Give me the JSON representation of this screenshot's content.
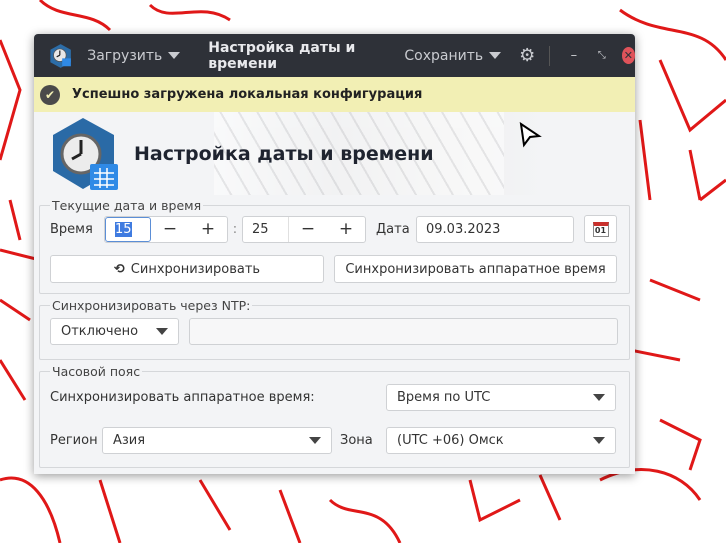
{
  "titlebar": {
    "load_label": "Загрузить",
    "title": "Настройка даты и времени",
    "save_label": "Сохранить",
    "minimize": "–",
    "restore": "⤡",
    "close": "✕"
  },
  "banner": {
    "message": "Успешно загружена локальная конфигурация"
  },
  "header": {
    "title": "Настройка даты и времени"
  },
  "current": {
    "legend": "Текущие дата и время",
    "time_label": "Время",
    "hours": "15",
    "minutes": "25",
    "separator": ":",
    "date_label": "Дата",
    "date": "09.03.2023",
    "calendar_day": "01",
    "minus": "−",
    "plus": "+",
    "sync_button": "Синхронизировать",
    "sync_hw_button": "Синхронизировать аппаратное время"
  },
  "ntp": {
    "legend": "Синхронизировать через NTP:",
    "mode": "Отключено",
    "server": ""
  },
  "timezone": {
    "legend": "Часовой пояс",
    "hw_label": "Синхронизировать аппаратное время:",
    "hw_value": "Время по UTC",
    "region_label": "Регион",
    "region": "Азия",
    "zone_label": "Зона",
    "zone": "(UTC +06) Омск"
  }
}
